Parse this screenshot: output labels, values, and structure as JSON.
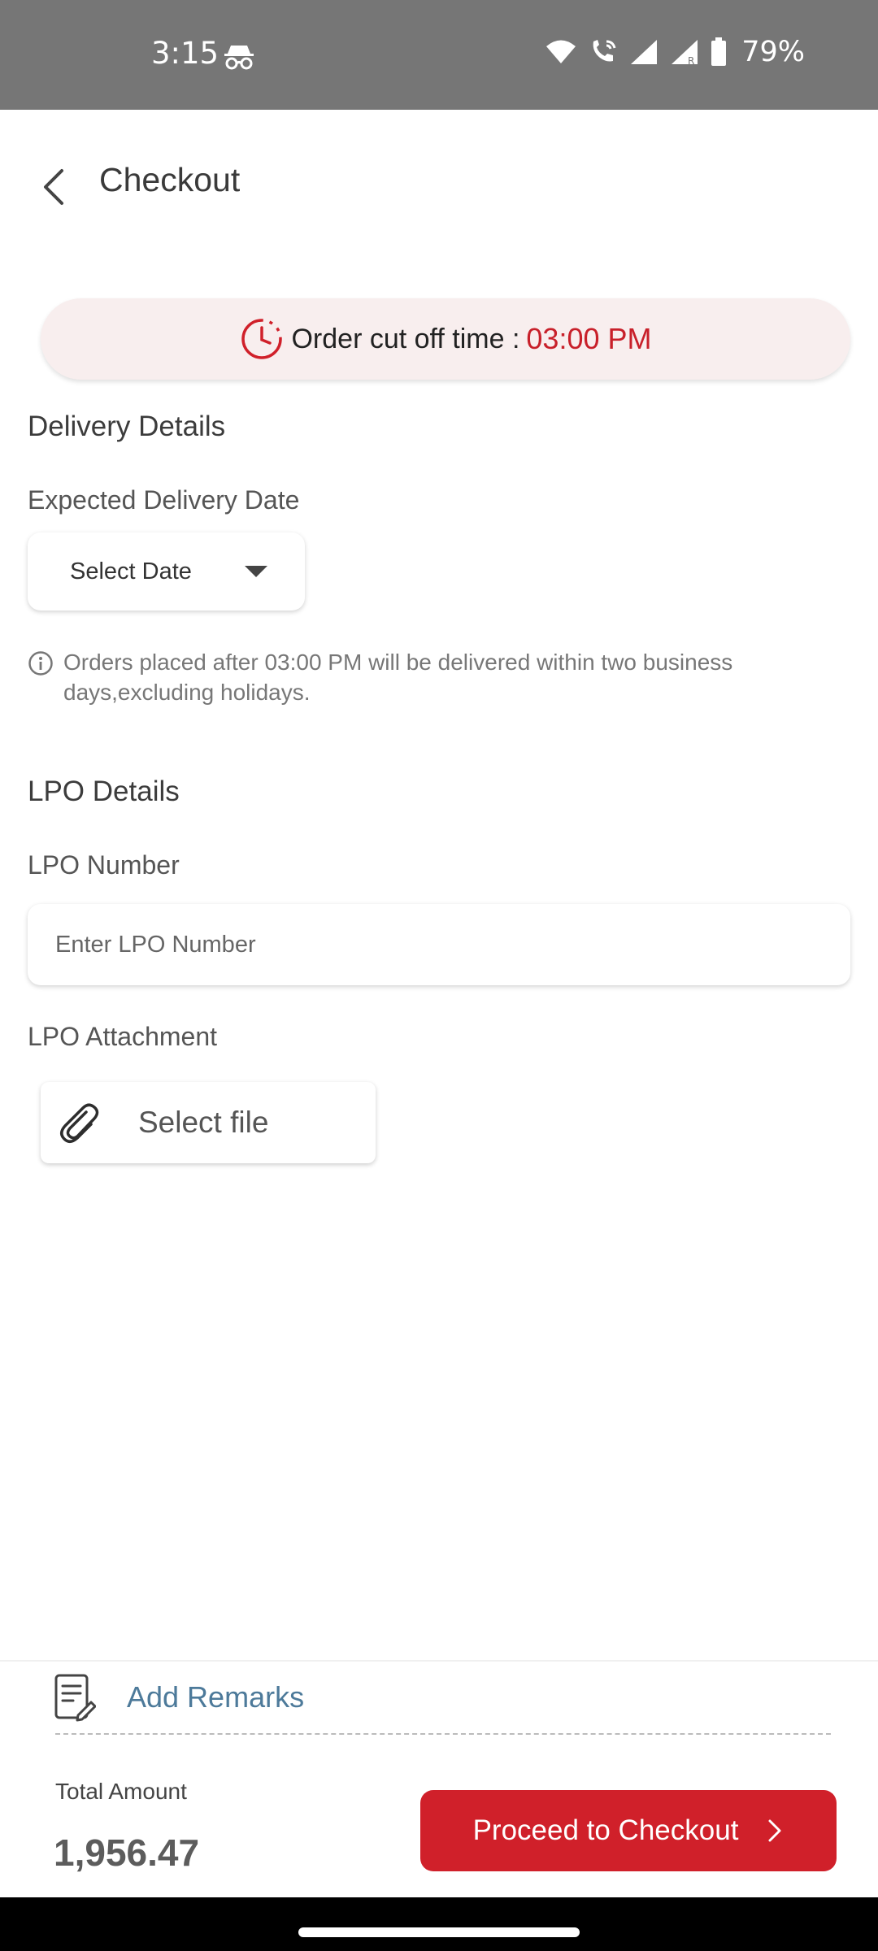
{
  "status_bar": {
    "time": "3:15",
    "battery": "79%",
    "icons": [
      "incognito-icon",
      "wifi-icon",
      "wifi-calling-icon",
      "signal-icon",
      "signal-roaming-icon",
      "battery-icon"
    ]
  },
  "header": {
    "title": "Checkout",
    "back_icon": "back-arrow-icon"
  },
  "cutoff": {
    "label": "Order cut off time :",
    "time": "03:00 PM",
    "accent_color": "#d0202a"
  },
  "delivery": {
    "section_title": "Delivery Details",
    "date_label": "Expected Delivery Date",
    "date_value": "Select Date",
    "info_text": "Orders placed after 03:00 PM will be delivered within two business days,excluding holidays."
  },
  "lpo": {
    "section_title": "LPO Details",
    "number_label": "LPO Number",
    "number_placeholder": "Enter LPO Number",
    "number_value": "",
    "attachment_label": "LPO Attachment",
    "file_button_label": "Select file"
  },
  "footer": {
    "remarks_label": "Add Remarks",
    "total_label": "Total Amount",
    "total_value": "1,956.47",
    "checkout_label": "Proceed to Checkout"
  }
}
